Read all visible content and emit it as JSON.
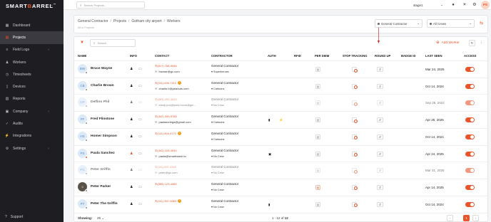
{
  "brand": {
    "prefix": "SMART",
    "accent": "B",
    "rest": "ARREL",
    "mark": "™",
    "collapse_icon": "double-chevron-left-icon"
  },
  "sidebar": {
    "items": [
      {
        "label": "Dashboard",
        "icon": "grid-icon",
        "active": false,
        "chevron": false
      },
      {
        "label": "Projects",
        "icon": "folder-icon",
        "active": true,
        "chevron": false
      },
      {
        "label": "Field Logs",
        "icon": "list-icon",
        "active": false,
        "chevron": true
      },
      {
        "label": "Workers",
        "icon": "user-icon",
        "active": false,
        "chevron": false
      },
      {
        "label": "Timesheets",
        "icon": "clock-icon",
        "active": false,
        "chevron": false
      },
      {
        "label": "Devices",
        "icon": "device-icon",
        "active": false,
        "chevron": false
      },
      {
        "label": "Reports",
        "icon": "report-icon",
        "active": false,
        "chevron": false
      },
      {
        "label": "Company",
        "icon": "building-icon",
        "active": false,
        "chevron": true
      },
      {
        "label": "Audits",
        "icon": "audit-icon",
        "active": false,
        "chevron": false
      },
      {
        "label": "Integrations",
        "icon": "plug-icon",
        "active": false,
        "chevron": false
      },
      {
        "label": "Settings",
        "icon": "gear-icon",
        "active": false,
        "chevron": true
      }
    ],
    "support_label": "Support"
  },
  "topbar": {
    "search_placeholder": "Search Projects...",
    "stage": "stage1",
    "avatar_initials": "PS"
  },
  "breadcrumb": {
    "items": [
      "General Contractor",
      "Projects",
      "Gotham city airport",
      "Workers"
    ],
    "sub": "All in Projects",
    "contractor_select": "General Contractor",
    "crew_select": "All Crews"
  },
  "panel": {
    "search_placeholder": "Search",
    "add_worker_label": "Add Worker"
  },
  "columns": [
    "NAME",
    "INFO",
    "CONTACT",
    "CONTRACTOR",
    "AUTH",
    "RFID",
    "PER DIEM",
    "STOP TRACKING",
    "ROUND UP",
    "BADGE ID",
    "LAST SEEN",
    "ACCESS"
  ],
  "workers": [
    {
      "initials": "BW",
      "name": "Bruce Wayne",
      "phone": "(917) 788-9946",
      "warn": false,
      "email": "bruwar@gc.com",
      "contractor": "General Contractor",
      "crew": "Superheroes",
      "last_seen": "Mar 24, 2025",
      "dim": false,
      "photo": false,
      "status": "grey",
      "auth": [
        "",
        ""
      ],
      "perdiem_orange": false,
      "info_orange": false
    },
    {
      "initials": "CB",
      "name": "Charlie Brown",
      "phone": "(111) 639-7412",
      "warn": true,
      "email": "charlie.b@peanuts.com",
      "contractor": "General Contractor",
      "crew": "Cartoons",
      "last_seen": "Oct 14, 2024",
      "dim": false,
      "photo": false,
      "status": "grey",
      "auth": [
        "",
        ""
      ],
      "perdiem_orange": false,
      "info_orange": false
    },
    {
      "initials": "DP",
      "name": "Delfino Phil",
      "phone": "(665) 255-3639",
      "warn": false,
      "email": "emoji.pok@pers.hccm@ga...",
      "contractor": "General Contractor",
      "crew": "No Crew",
      "last_seen": "Sep 25, 2024",
      "dim": true,
      "photo": false,
      "status": "grey",
      "auth": [
        "",
        ""
      ],
      "perdiem_orange": false,
      "info_orange": false
    },
    {
      "initials": "FF",
      "name": "Fred Flinstone",
      "phone": "(442) 300-9785",
      "warn": false,
      "email": "paulasorlega@gmail.com",
      "contractor": "General Contractor",
      "crew": "Cartoons",
      "last_seen": "Apr 25, 2025",
      "dim": false,
      "photo": false,
      "status": "grey",
      "auth": [
        "▮",
        "⚡"
      ],
      "perdiem_orange": false,
      "info_orange": false
    },
    {
      "initials": "HS",
      "name": "Homer Simpson",
      "phone": "(111) 804-4772",
      "warn": true,
      "email": "",
      "contractor": "General Contractor",
      "crew": "Cartoons",
      "last_seen": "Oct 14, 2024",
      "dim": false,
      "photo": false,
      "status": "grey",
      "auth": [
        "",
        ""
      ],
      "perdiem_orange": false,
      "info_orange": false
    },
    {
      "initials": "PS",
      "name": "Paula Sanchez",
      "phone": "(442) 226-4940",
      "warn": false,
      "email": "paula@smartbarrel.io",
      "contractor": "General Contractor",
      "crew": "No Crew",
      "last_seen": "Apr 24, 2025",
      "dim": false,
      "photo": false,
      "status": "red",
      "auth": [
        "▣",
        ""
      ],
      "perdiem_orange": false,
      "info_orange": true
    },
    {
      "initials": "PG",
      "name": "Peter Griffin",
      "phone": "(111) 597-4940",
      "warn": false,
      "email": "peter@gc.com",
      "contractor": "General Contractor",
      "crew": "No Crew",
      "last_seen": "Mar 31, 2025",
      "dim": true,
      "photo": false,
      "status": "grey",
      "auth": [
        "",
        ""
      ],
      "perdiem_orange": false,
      "info_orange": false
    },
    {
      "initials": "PP",
      "name": "Peter Parker",
      "phone": "(555) 123-4460",
      "warn": false,
      "email": "",
      "contractor": "General Contractor",
      "crew": "No Crew",
      "last_seen": "Apr 14, 2025",
      "dim": false,
      "photo": true,
      "status": "grey",
      "auth": [
        "",
        ""
      ],
      "perdiem_orange": true,
      "info_orange": false
    },
    {
      "initials": "PT",
      "name": "Peter The Griffin",
      "phone": "(111) 557-9983",
      "warn": true,
      "email": "",
      "contractor": "General Contractor",
      "crew": "No Crew",
      "last_seen": "Oct 14, 2024",
      "dim": false,
      "photo": false,
      "status": "grey",
      "auth": [
        "▮",
        ""
      ],
      "perdiem_orange": false,
      "info_orange": false
    }
  ],
  "footer": {
    "showing_label": "Showing:",
    "per_page": "25",
    "range_prefix": "1 - 12 of",
    "range_total": "12",
    "current_page": "1"
  }
}
